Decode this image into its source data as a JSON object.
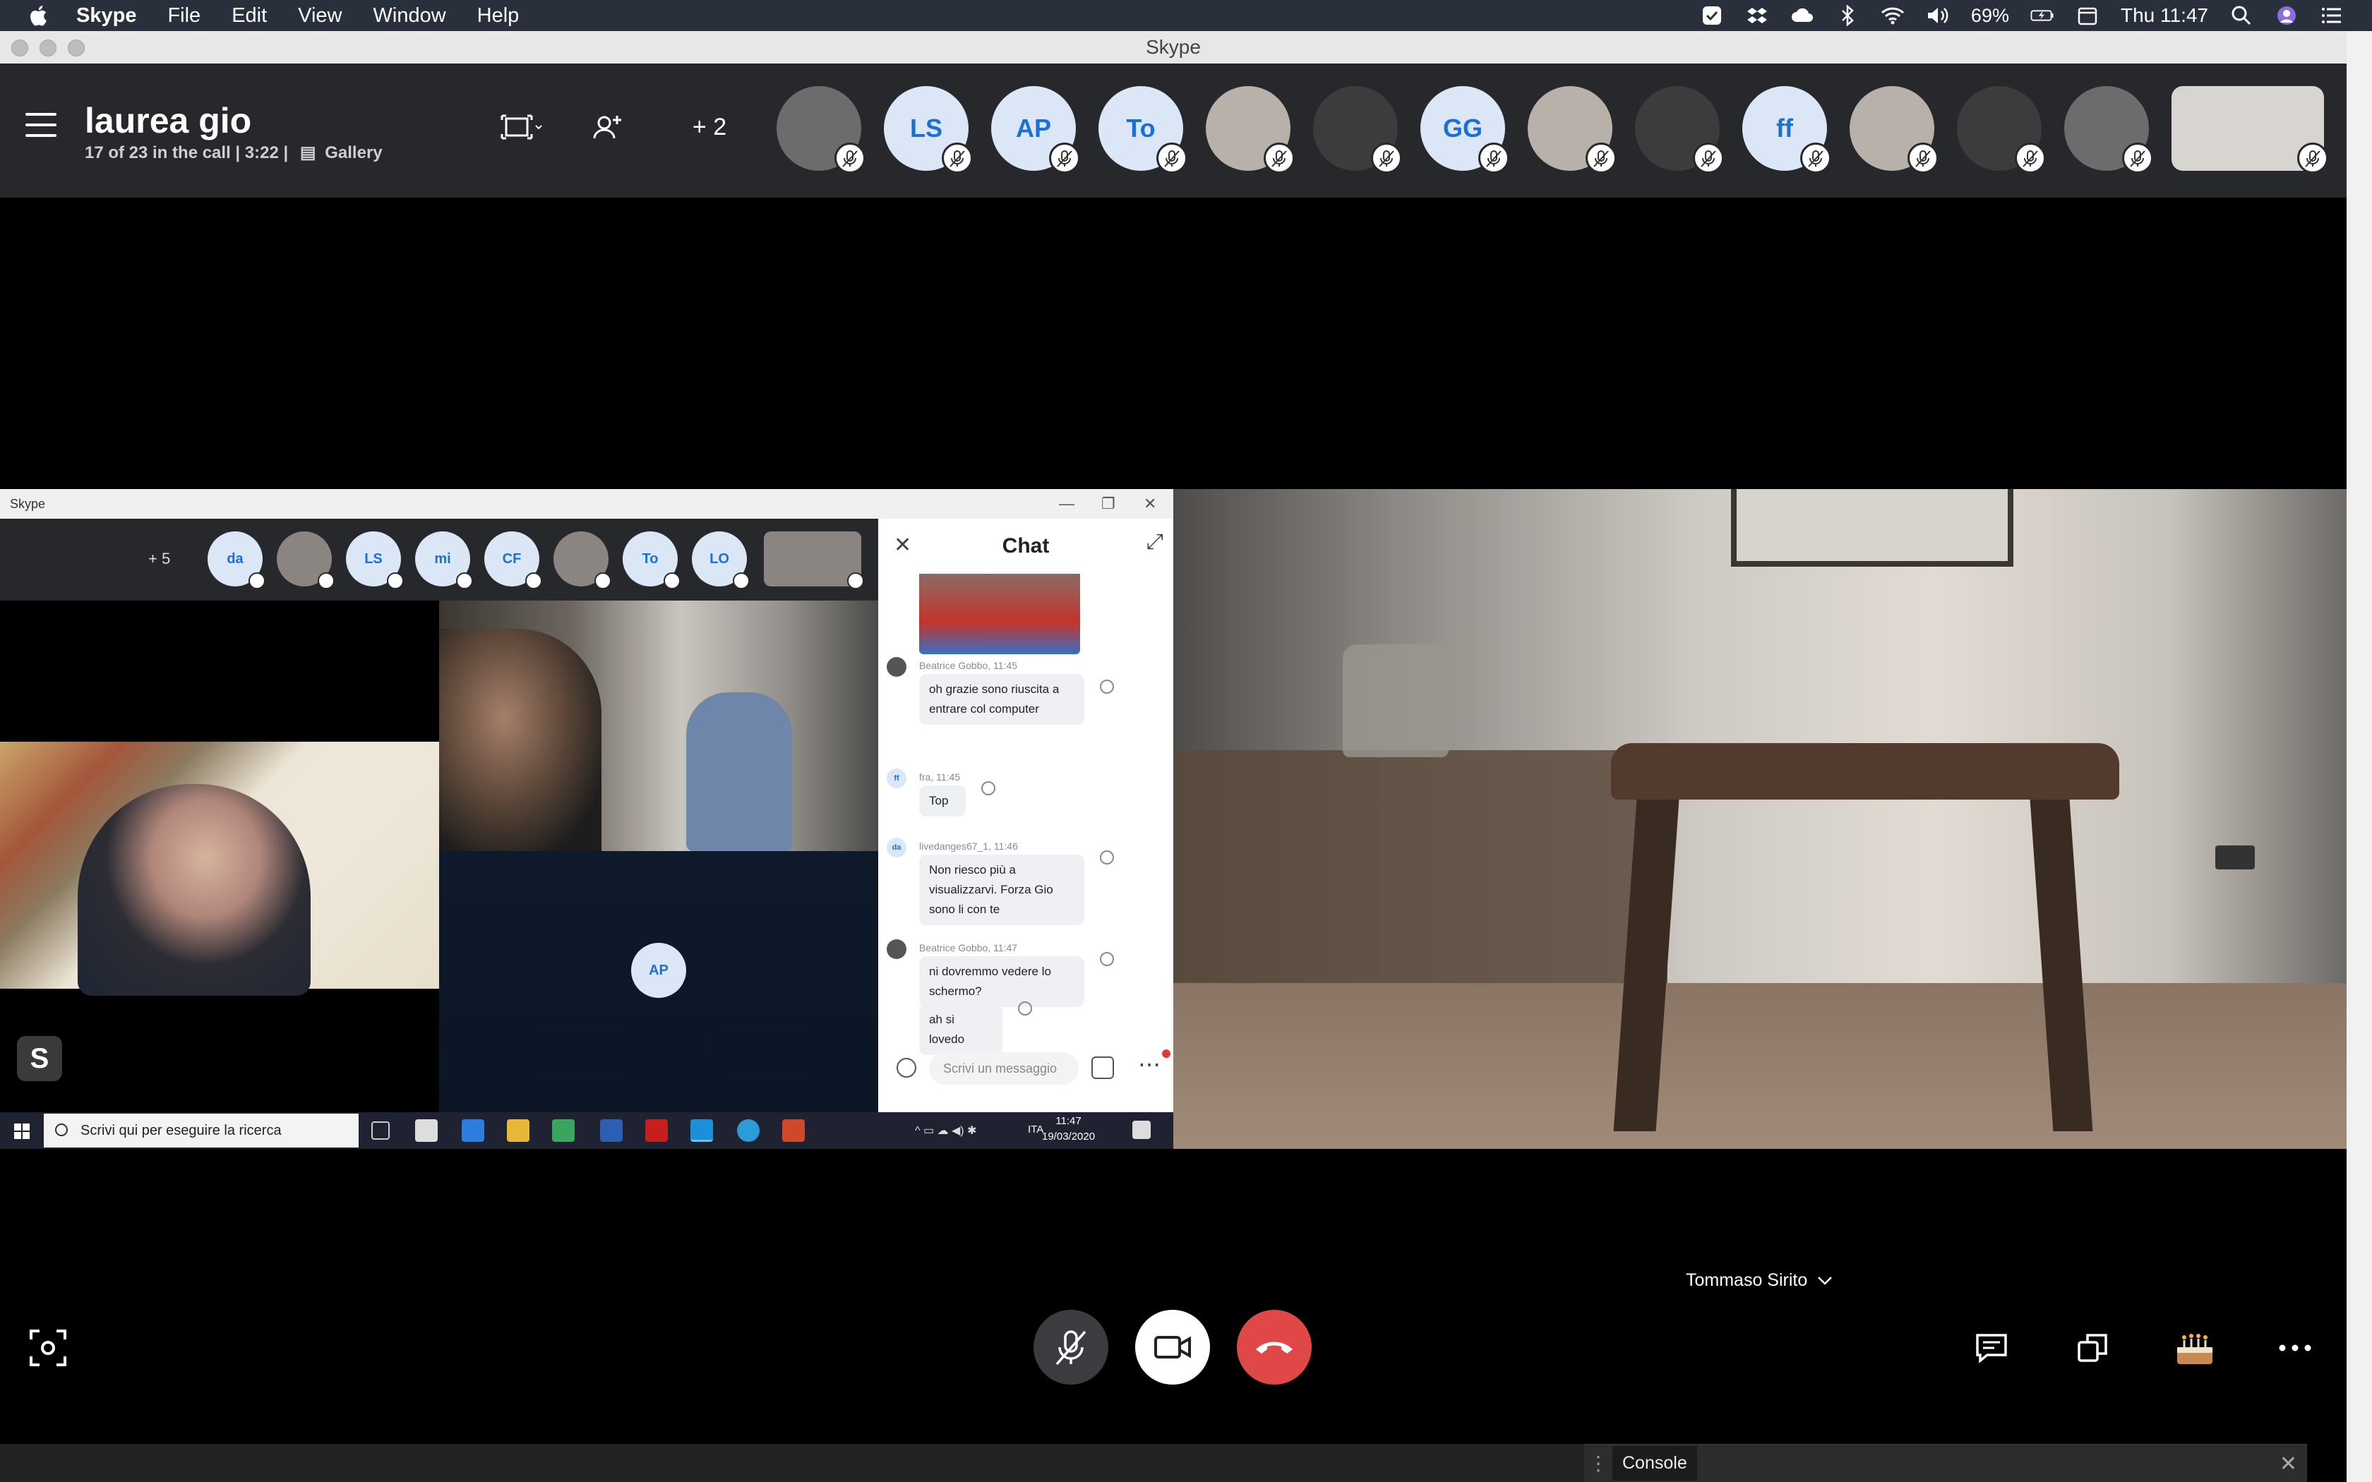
{
  "menubar": {
    "app_name": "Skype",
    "menus": [
      "File",
      "Edit",
      "View",
      "Window",
      "Help"
    ],
    "battery": "69%",
    "clock": "Thu 11:47"
  },
  "window": {
    "title": "Skype"
  },
  "call": {
    "title": "laurea gio",
    "status": "17 of 23 in the call | 3:22 |",
    "view_mode": "Gallery",
    "more_count": "+ 2",
    "participants": [
      {
        "label": "",
        "photo": true
      },
      {
        "label": "LS"
      },
      {
        "label": "AP"
      },
      {
        "label": "To"
      },
      {
        "label": "",
        "photo": true
      },
      {
        "label": "",
        "photo": true
      },
      {
        "label": "GG"
      },
      {
        "label": "",
        "photo": true
      },
      {
        "label": "",
        "photo": true
      },
      {
        "label": "ff"
      },
      {
        "label": "",
        "photo": true
      },
      {
        "label": "",
        "photo": true
      },
      {
        "label": "",
        "photo": true
      },
      {
        "label": "",
        "photo": true,
        "tile": true
      }
    ]
  },
  "shared_screen": {
    "window_title": "Skype",
    "more_count": "+ 5",
    "participants": [
      "da",
      "",
      "LS",
      "mi",
      "CF",
      "",
      "To",
      "LO",
      ""
    ],
    "tile_avatar": "AP",
    "chat": {
      "title": "Chat",
      "messages": [
        {
          "meta": "Beatrice Gobbo, 11:45",
          "text": "oh grazie sono riuscita a entrare col computer",
          "avatar": ""
        },
        {
          "meta": "fra, 11:45",
          "text": "Top",
          "avatar": "ff"
        },
        {
          "meta": "livedanges67_1, 11:46",
          "text": "Non riesco più a visualizzarvi. Forza Gio sono li con te",
          "avatar": "da"
        },
        {
          "meta": "Beatrice Gobbo, 11:47",
          "text": "ni dovremmo vedere lo schermo?",
          "avatar": ""
        },
        {
          "meta": "",
          "text": "ah si lovedo",
          "avatar": ""
        }
      ],
      "input_placeholder": "Scrivi un messaggio"
    },
    "taskbar": {
      "search_placeholder": "Scrivi qui per eseguire la ricerca",
      "lang": "ITA",
      "time": "11:47",
      "date": "19/03/2020"
    }
  },
  "speaker": {
    "name": "Tommaso Sirito"
  },
  "console": {
    "label": "Console"
  }
}
